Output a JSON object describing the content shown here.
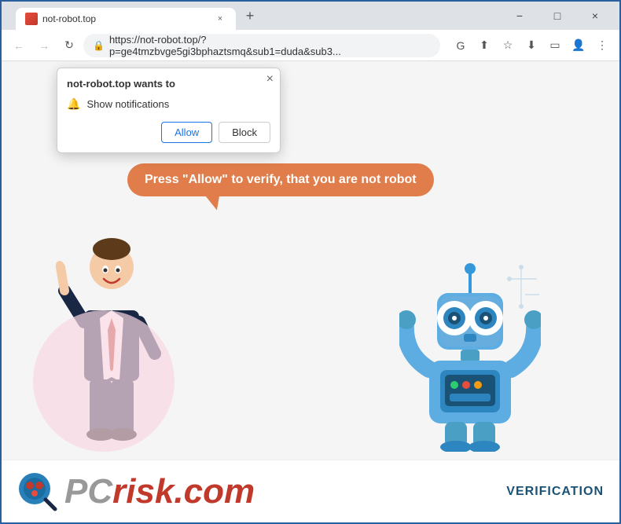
{
  "window": {
    "tab_title": "not-robot.top",
    "url": "https://not-robot.top/?p=ge4tmzbvge5gi3bphaztsmq&sub1=duda&sub3...",
    "new_tab_label": "+",
    "window_controls": [
      "−",
      "□",
      "×"
    ]
  },
  "nav": {
    "back": "←",
    "forward": "→",
    "reload": "↺",
    "lock_icon": "🔒"
  },
  "notification_popup": {
    "title": "not-robot.top wants to",
    "notification_label": "Show notifications",
    "allow_label": "Allow",
    "block_label": "Block",
    "close_label": "×"
  },
  "page": {
    "speech_bubble_text": "Press \"Allow\" to verify, that you are not robot",
    "verification_label": "VERIFICATION"
  },
  "pcrisk": {
    "logo_text_gray": "PC",
    "logo_text_red": "risk",
    "logo_suffix": ".com"
  }
}
